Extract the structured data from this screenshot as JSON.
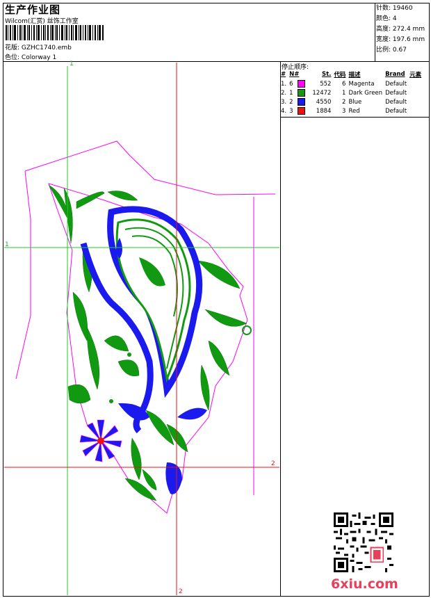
{
  "header": {
    "title": "生产作业图",
    "studio": "Wilcom(汇赏) 丝饰工作室",
    "design_label": "花版:",
    "design_value": "GZHC1740.emb",
    "colorway_label": "色位:",
    "colorway_value": "Colorway 1"
  },
  "stats": {
    "stitches_label": "针数:",
    "stitches_value": "19460",
    "colors_label": "颜色:",
    "colors_value": "4",
    "height_label": "高度:",
    "height_value": "272.4 mm",
    "width_label": "宽度:",
    "width_value": "197.6 mm",
    "scale_label": "比例:",
    "scale_value": "0.67"
  },
  "stop_sequence": {
    "title": "停止顺序:",
    "headers": [
      "#",
      "N#",
      "St.",
      "代码",
      "描述",
      "Brand",
      "元素"
    ],
    "rows": [
      {
        "idx": "1.",
        "n": "6",
        "color": "#ff00ff",
        "stitches": "552",
        "code": "6",
        "desc": "Magenta",
        "brand": "Default"
      },
      {
        "idx": "2.",
        "n": "1",
        "color": "#119911",
        "stitches": "12472",
        "code": "1",
        "desc": "Dark Green",
        "brand": "Default"
      },
      {
        "idx": "3.",
        "n": "2",
        "color": "#1a1aee",
        "stitches": "4550",
        "code": "2",
        "desc": "Blue",
        "brand": "Default"
      },
      {
        "idx": "4.",
        "n": "3",
        "color": "#ee1111",
        "stitches": "1884",
        "code": "3",
        "desc": "Red",
        "brand": "Default"
      }
    ]
  },
  "guides": {
    "green_vertical_label": "1",
    "green_horizontal_label": "1",
    "red_horizontal_label": "2",
    "red_vertical_label": "2"
  },
  "watermark": "6xiu.com"
}
